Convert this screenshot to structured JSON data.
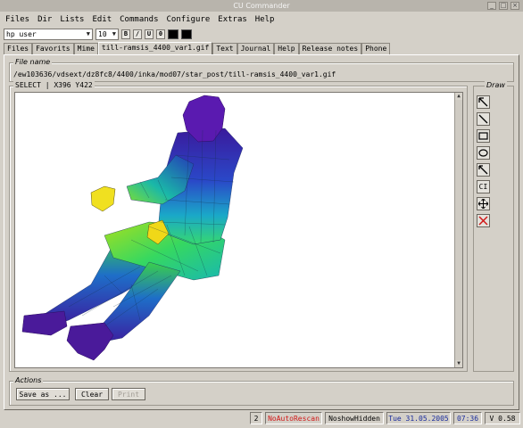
{
  "window": {
    "title": "CU Commander"
  },
  "menu": [
    "Files",
    "Dir",
    "Lists",
    "Edit",
    "Commands",
    "Configure",
    "Extras",
    "Help"
  ],
  "toolbar": {
    "font_value": "hp user",
    "size_value": "10",
    "bold_label": "B",
    "italic_label": "/",
    "underline_label": "U",
    "outline_label": "0",
    "fg_color": "#000000",
    "bg_color": "#000000"
  },
  "tabs": [
    {
      "label": "Files",
      "active": false
    },
    {
      "label": "Favorits",
      "active": false
    },
    {
      "label": "Mime",
      "active": false
    },
    {
      "label": "till-ramsis_4400_var1.gif",
      "active": true
    },
    {
      "label": "Text",
      "active": false
    },
    {
      "label": "Journal",
      "active": false
    },
    {
      "label": "Help",
      "active": false
    },
    {
      "label": "Release notes",
      "active": false
    },
    {
      "label": "Phone",
      "active": false
    }
  ],
  "filename_group": {
    "title": "File name",
    "value": "/ew103636/vdsext/dz8fc8/4400/inka/mod07/star_post/till-ramsis_4400_var1.gif"
  },
  "canvas_group": {
    "title": "SELECT | X396 Y422"
  },
  "draw_group": {
    "title": "Draw",
    "tools": [
      {
        "name": "arrow-tool",
        "icon": "arrow-nw-icon"
      },
      {
        "name": "line-tool",
        "icon": "line-icon"
      },
      {
        "name": "rectangle-tool",
        "icon": "rectangle-icon"
      },
      {
        "name": "ellipse-tool",
        "icon": "ellipse-icon"
      },
      {
        "name": "pointer-line-tool",
        "icon": "arrow-line-icon"
      },
      {
        "name": "text-tool",
        "icon": "text-cursor-icon",
        "label": "C"
      },
      {
        "name": "move-tool",
        "icon": "move-icon"
      },
      {
        "name": "delete-tool",
        "icon": "red-x-icon"
      }
    ]
  },
  "actions_group": {
    "title": "Actions",
    "save_label": "Save as ...",
    "clear_label": "Clear",
    "print_label": "Print"
  },
  "status": {
    "count": "2",
    "rescan": "NoAutoRescan",
    "hidden": "NoshowHidden",
    "date": "Tue 31.05.2005",
    "time": "07:36",
    "version": "V 0.58"
  },
  "colors": {
    "rescan": "#d01818",
    "date": "#1a2c9c",
    "time": "#1a2c9c",
    "accent_red": "#d01818"
  }
}
